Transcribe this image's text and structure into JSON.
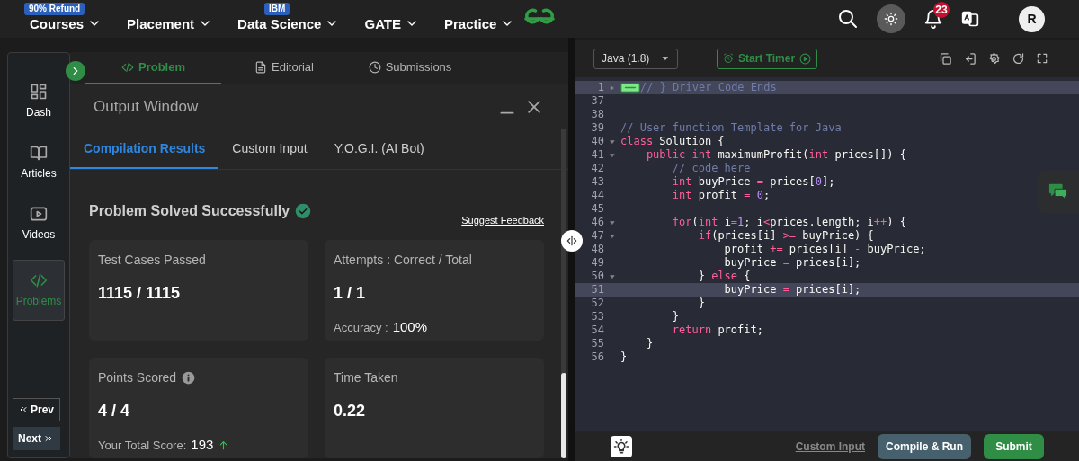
{
  "nav": {
    "items": [
      {
        "label": "Courses",
        "badge": "90% Refund"
      },
      {
        "label": "Placement"
      },
      {
        "label": "Data Science",
        "badge": "IBM"
      },
      {
        "label": "GATE"
      },
      {
        "label": "Practice"
      }
    ],
    "notifications": "23",
    "avatar": "R"
  },
  "sidebar": {
    "items": [
      {
        "label": "Dash",
        "selected": false
      },
      {
        "label": "Articles",
        "selected": false
      },
      {
        "label": "Videos",
        "selected": false
      },
      {
        "label": "Problems",
        "selected": true
      }
    ],
    "prev": "Prev",
    "next": "Next"
  },
  "problem_tabs": [
    {
      "label": "Problem",
      "selected": true
    },
    {
      "label": "Editorial",
      "selected": false
    },
    {
      "label": "Submissions",
      "selected": false
    }
  ],
  "output_window": {
    "title": "Output Window",
    "tabs": [
      {
        "label": "Compilation Results",
        "selected": true
      },
      {
        "label": "Custom Input",
        "selected": false
      },
      {
        "label": "Y.O.G.I. (AI Bot)",
        "selected": false
      }
    ],
    "status": "Problem Solved Successfully",
    "feedback_link": "Suggest Feedback",
    "cards": [
      {
        "label": "Test Cases Passed",
        "value": "1115 / 1115",
        "has_info": false
      },
      {
        "label": "Attempts : Correct / Total",
        "value": "1 / 1",
        "sub_label": "Accuracy :",
        "sub_value": "100%",
        "has_info": false,
        "trend_up": false
      },
      {
        "label": "Points Scored",
        "value": "4 / 4",
        "sub_label": "Your Total Score:",
        "sub_value": "193",
        "has_info": true,
        "trend_up": true
      },
      {
        "label": "Time Taken",
        "value": "0.22",
        "has_info": false
      }
    ]
  },
  "editor": {
    "language": "Java (1.8)",
    "timer": "Start Timer",
    "lines": [
      {
        "number": "1",
        "foldable": true,
        "folded": true,
        "highlighted": true,
        "tokens": [
          {
            "kind": "comment",
            "text": "// } Driver Code Ends"
          }
        ]
      },
      {
        "number": "37",
        "foldable": false,
        "folded": false,
        "highlighted": false
      },
      {
        "number": "38",
        "foldable": false,
        "folded": false,
        "highlighted": false
      },
      {
        "number": "39",
        "foldable": false,
        "folded": false,
        "highlighted": false,
        "tokens": [
          {
            "kind": "comment",
            "text": "// User function Template for Java"
          }
        ]
      },
      {
        "number": "40",
        "foldable": true,
        "folded": false,
        "highlighted": false,
        "tokens": [
          {
            "kind": "keyword",
            "text": "class"
          },
          {
            "kind": "plain",
            "text": " Solution {"
          }
        ]
      },
      {
        "number": "41",
        "foldable": true,
        "folded": false,
        "highlighted": false,
        "tokens": [
          {
            "kind": "keyword",
            "text": "    public"
          },
          {
            "kind": "keyword",
            "text": " int"
          },
          {
            "kind": "plain",
            "text": " maximumProfit("
          },
          {
            "kind": "keyword",
            "text": "int"
          },
          {
            "kind": "plain",
            "text": " prices[]) {"
          }
        ]
      },
      {
        "number": "42",
        "foldable": false,
        "folded": false,
        "highlighted": false,
        "tokens": [
          {
            "kind": "comment",
            "text": "        // code here"
          }
        ]
      },
      {
        "number": "43",
        "foldable": false,
        "folded": false,
        "highlighted": false,
        "tokens": [
          {
            "kind": "keyword",
            "text": "        int"
          },
          {
            "kind": "plain",
            "text": " buyPrice "
          },
          {
            "kind": "operator",
            "text": "="
          },
          {
            "kind": "plain",
            "text": " prices["
          },
          {
            "kind": "number",
            "text": "0"
          },
          {
            "kind": "plain",
            "text": "];"
          }
        ]
      },
      {
        "number": "44",
        "foldable": false,
        "folded": false,
        "highlighted": false,
        "tokens": [
          {
            "kind": "keyword",
            "text": "        int"
          },
          {
            "kind": "plain",
            "text": " profit "
          },
          {
            "kind": "operator",
            "text": "="
          },
          {
            "kind": "number",
            "text": " 0"
          },
          {
            "kind": "plain",
            "text": ";"
          }
        ]
      },
      {
        "number": "45",
        "foldable": false,
        "folded": false,
        "highlighted": false
      },
      {
        "number": "46",
        "foldable": true,
        "folded": false,
        "highlighted": false,
        "tokens": [
          {
            "kind": "keyword",
            "text": "        for"
          },
          {
            "kind": "plain",
            "text": "("
          },
          {
            "kind": "keyword",
            "text": "int"
          },
          {
            "kind": "plain",
            "text": " i"
          },
          {
            "kind": "operator",
            "text": "="
          },
          {
            "kind": "number",
            "text": "1"
          },
          {
            "kind": "plain",
            "text": "; i"
          },
          {
            "kind": "operator",
            "text": "<"
          },
          {
            "kind": "plain",
            "text": "prices.length; i"
          },
          {
            "kind": "operator",
            "text": "++"
          },
          {
            "kind": "plain",
            "text": ") {"
          }
        ]
      },
      {
        "number": "47",
        "foldable": true,
        "folded": false,
        "highlighted": false,
        "tokens": [
          {
            "kind": "keyword",
            "text": "            if"
          },
          {
            "kind": "plain",
            "text": "(prices[i] "
          },
          {
            "kind": "operator",
            "text": ">="
          },
          {
            "kind": "plain",
            "text": " buyPrice) {"
          }
        ]
      },
      {
        "number": "48",
        "foldable": false,
        "folded": false,
        "highlighted": false,
        "tokens": [
          {
            "kind": "plain",
            "text": "                profit "
          },
          {
            "kind": "operator",
            "text": "+="
          },
          {
            "kind": "plain",
            "text": " prices[i] "
          },
          {
            "kind": "operator",
            "text": "-"
          },
          {
            "kind": "plain",
            "text": " buyPrice;"
          }
        ]
      },
      {
        "number": "49",
        "foldable": false,
        "folded": false,
        "highlighted": false,
        "tokens": [
          {
            "kind": "plain",
            "text": "                buyPrice "
          },
          {
            "kind": "operator",
            "text": "="
          },
          {
            "kind": "plain",
            "text": " prices[i];"
          }
        ]
      },
      {
        "number": "50",
        "foldable": true,
        "folded": false,
        "highlighted": false,
        "tokens": [
          {
            "kind": "plain",
            "text": "            } "
          },
          {
            "kind": "keyword",
            "text": "else"
          },
          {
            "kind": "plain",
            "text": " {"
          }
        ]
      },
      {
        "number": "51",
        "foldable": false,
        "folded": false,
        "highlighted": true,
        "tokens": [
          {
            "kind": "plain",
            "text": "                buyPrice "
          },
          {
            "kind": "operator",
            "text": "="
          },
          {
            "kind": "plain",
            "text": " prices[i];"
          }
        ]
      },
      {
        "number": "52",
        "foldable": false,
        "folded": false,
        "highlighted": false,
        "tokens": [
          {
            "kind": "plain",
            "text": "            }"
          }
        ]
      },
      {
        "number": "53",
        "foldable": false,
        "folded": false,
        "highlighted": false,
        "tokens": [
          {
            "kind": "plain",
            "text": "        }"
          }
        ]
      },
      {
        "number": "54",
        "foldable": false,
        "folded": false,
        "highlighted": false,
        "tokens": [
          {
            "kind": "keyword",
            "text": "        return"
          },
          {
            "kind": "plain",
            "text": " profit;"
          }
        ]
      },
      {
        "number": "55",
        "foldable": false,
        "folded": false,
        "highlighted": false,
        "tokens": [
          {
            "kind": "plain",
            "text": "    }"
          }
        ]
      },
      {
        "number": "56",
        "foldable": false,
        "folded": false,
        "highlighted": false,
        "tokens": [
          {
            "kind": "plain",
            "text": "}"
          }
        ]
      }
    ]
  },
  "footer": {
    "custom_input": "Custom Input",
    "compile": "Compile & Run",
    "submit": "Submit"
  }
}
